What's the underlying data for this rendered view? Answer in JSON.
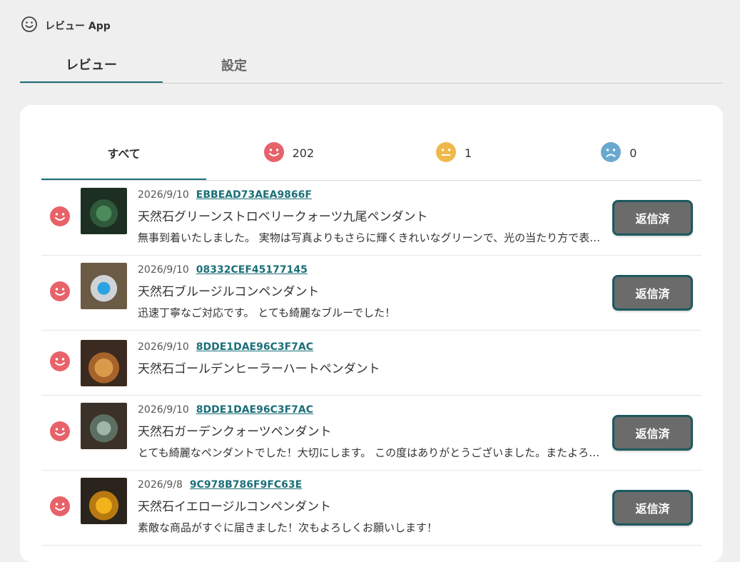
{
  "app": {
    "title": "レビュー App"
  },
  "main_tabs": [
    {
      "label": "レビュー",
      "active": true
    },
    {
      "label": "設定",
      "active": false
    }
  ],
  "filters": {
    "all_label": "すべて",
    "positive_count": "202",
    "neutral_count": "1",
    "negative_count": "0"
  },
  "colors": {
    "accent": "#1b6f78",
    "positive": "#e8626a",
    "neutral": "#f0b84a",
    "negative": "#6aa9cf",
    "button_bg": "#6b6b6b"
  },
  "reviews": [
    {
      "date": "2026/9/10",
      "order_id": "EBBEAD73AEA9866F",
      "product": "天然石グリーンストロベリークォーツ九尾ペンダント",
      "comment": "無事到着いたしました。 実物は写真よりもさらに輝くきれいなグリーンで、光の当たり方で表情が変わります。",
      "status": "返信済",
      "sentiment": "positive"
    },
    {
      "date": "2026/9/10",
      "order_id": "08332CEF45177145",
      "product": "天然石ブルージルコンペンダント",
      "comment": "迅速丁寧なご対応です。 とても綺麗なブルーでした！",
      "status": "返信済",
      "sentiment": "positive"
    },
    {
      "date": "2026/9/10",
      "order_id": "8DDE1DAE96C3F7AC",
      "product": "天然石ゴールデンヒーラーハートペンダント",
      "comment": "",
      "status": "",
      "sentiment": "positive"
    },
    {
      "date": "2026/9/10",
      "order_id": "8DDE1DAE96C3F7AC",
      "product": "天然石ガーデンクォーツペンダント",
      "comment": "とても綺麗なペンダントでした！大切にします。 この度はありがとうございました。またよろしくお願いします。",
      "status": "返信済",
      "sentiment": "positive"
    },
    {
      "date": "2026/9/8",
      "order_id": "9C978B786F9FC63E",
      "product": "天然石イエロージルコンペンダント",
      "comment": "素敵な商品がすぐに届きました！次もよろしくお願いします！",
      "status": "返信済",
      "sentiment": "positive"
    }
  ]
}
